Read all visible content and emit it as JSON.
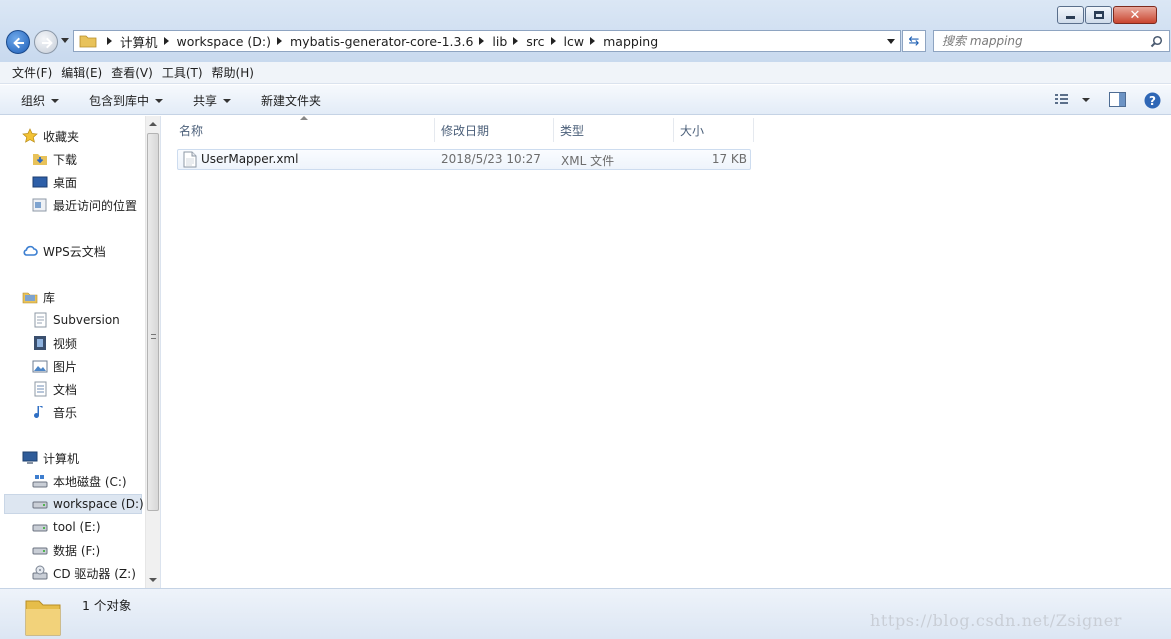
{
  "window": {
    "minimize_label": "Minimize",
    "maximize_label": "Maximize",
    "close_label": "Close"
  },
  "address": {
    "crumbs": [
      "计算机",
      "workspace (D:)",
      "mybatis-generator-core-1.3.6",
      "lib",
      "src",
      "lcw",
      "mapping"
    ]
  },
  "search": {
    "placeholder": "搜索 mapping"
  },
  "menubar": {
    "items": [
      "文件(F)",
      "编辑(E)",
      "查看(V)",
      "工具(T)",
      "帮助(H)"
    ]
  },
  "toolbar": {
    "organize": "组织",
    "include_in_library": "包含到库中",
    "share": "共享",
    "new_folder": "新建文件夹"
  },
  "nav": {
    "favorites": "收藏夹",
    "downloads": "下载",
    "desktop": "桌面",
    "recent": "最近访问的位置",
    "wps": "WPS云文档",
    "library": "库",
    "subversion": "Subversion",
    "videos": "视频",
    "pictures": "图片",
    "documents": "文档",
    "music": "音乐",
    "computer": "计算机",
    "drive_c": "本地磁盘 (C:)",
    "drive_d": "workspace (D:)",
    "drive_e": "tool (E:)",
    "drive_f": "数据 (F:)",
    "drive_z": "CD 驱动器 (Z:)"
  },
  "columns": {
    "name": "名称",
    "modified": "修改日期",
    "type": "类型",
    "size": "大小"
  },
  "files": [
    {
      "name": "UserMapper.xml",
      "modified": "2018/5/23 10:27",
      "type": "XML 文件",
      "size": "17 KB"
    }
  ],
  "status": {
    "count": "1 个对象"
  },
  "watermark": "https://blog.csdn.net/Zsigner",
  "colors": {
    "accent": "#1f5fb8",
    "selection": "#dde6f1",
    "chrome": "#dbe7f5"
  }
}
